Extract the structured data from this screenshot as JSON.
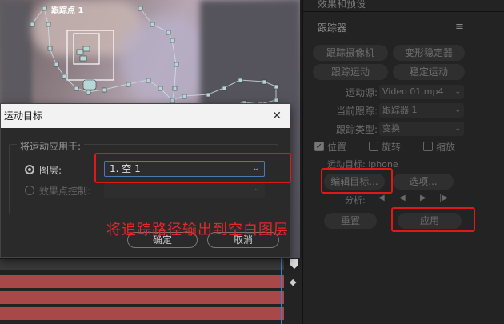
{
  "preview": {
    "track_point_label": "跟踪点 1"
  },
  "panel": {
    "top_header": "效果和预设",
    "tracker_title": "跟踪器",
    "menu_icon": "hamburger-icon",
    "btn_track_camera": "跟踪摄像机",
    "btn_warp_stabilize": "变形稳定器",
    "btn_track_motion": "跟踪运动",
    "btn_stabilize_motion": "稳定运动",
    "motion_source_label": "运动源:",
    "motion_source_value": "Video 01.mp4",
    "current_track_label": "当前跟踪:",
    "current_track_value": "跟踪器 1",
    "track_type_label": "跟踪类型:",
    "track_type_value": "变换",
    "check_position": "位置",
    "check_rotation": "旋转",
    "check_scale": "缩放",
    "motion_target_label": "运动目标: iphone",
    "btn_edit_target": "编辑目标...",
    "btn_options": "选项...",
    "analyze_label": "分析:",
    "btn_reset": "重置",
    "btn_apply": "应用"
  },
  "dialog": {
    "title": "运动目标",
    "group_title": "将运动应用于:",
    "radio_layer": "图层:",
    "radio_effect": "效果点控制:",
    "layer_value": "1. 空 1",
    "btn_ok": "确定",
    "btn_cancel": "取消"
  },
  "annotation": "将追踪路径输出到空白图层",
  "colors": {
    "annotation_red": "#e01818",
    "accent_blue": "#4a7ab5",
    "timeline_red": "#a84848"
  }
}
